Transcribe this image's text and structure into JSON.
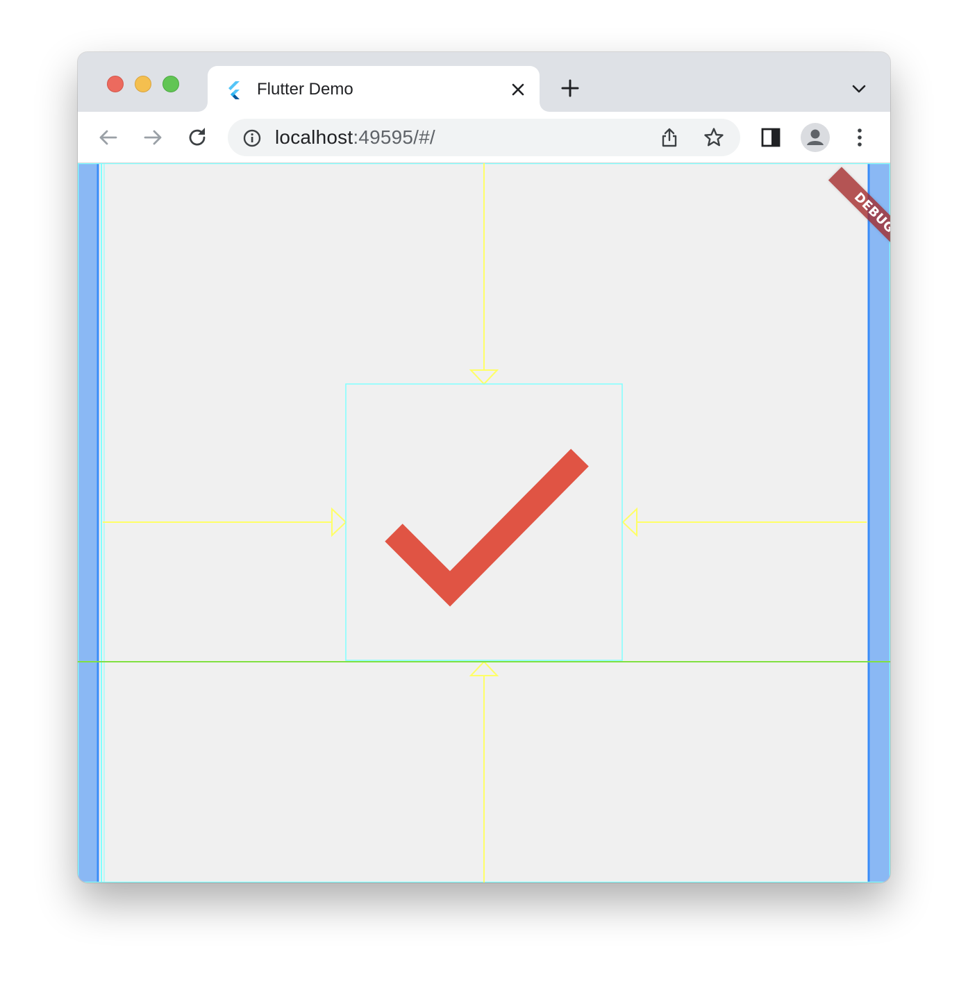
{
  "window": {
    "traffic_lights": [
      "close",
      "minimize",
      "maximize"
    ]
  },
  "tab": {
    "title": "Flutter Demo",
    "favicon": "flutter-logo-icon",
    "close_icon": "close-icon"
  },
  "tabstrip": {
    "new_tab_icon": "plus-icon",
    "tab_search_icon": "chevron-down-icon"
  },
  "toolbar": {
    "back_icon": "arrow-left-icon",
    "forward_icon": "arrow-right-icon",
    "reload_icon": "reload-icon",
    "side_panel_icon": "side-panel-icon",
    "profile_icon": "profile-avatar-icon",
    "menu_icon": "kebab-menu-icon"
  },
  "omnibox": {
    "site_info_icon": "info-icon",
    "url_host": "localhost",
    "url_rest": ":49595/#/",
    "share_icon": "share-icon",
    "bookmark_icon": "star-icon"
  },
  "content": {
    "debug_banner": "DEBUG",
    "main_icon": "check-icon",
    "colors": {
      "background": "#f0f0f0",
      "check": "#e05444",
      "debug_paint_boxes": "#80ffff",
      "debug_arrows": "#ffff66",
      "baseline": "#80e040",
      "side_bars": "#8ab8f4",
      "side_bar_edge": "#3a8cf8",
      "debug_banner": "#a32828"
    }
  }
}
